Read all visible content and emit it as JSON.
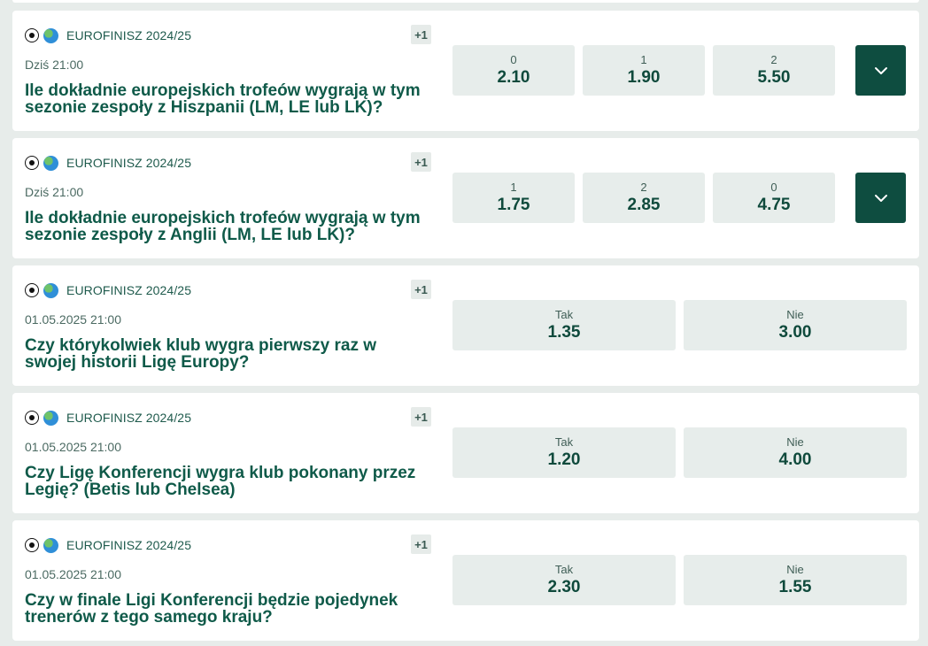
{
  "events": [
    {
      "league": "EUROFINISZ 2024/25",
      "badge": "+1",
      "time": "Dziś 21:00",
      "title": "Ile dokładnie europejskich trofeów wygrają w tym sezonie zespoły z Hiszpanii (LM, LE lub LK)?",
      "odds": [
        {
          "label": "0",
          "value": "2.10"
        },
        {
          "label": "1",
          "value": "1.90"
        },
        {
          "label": "2",
          "value": "5.50"
        }
      ],
      "has_expand": true
    },
    {
      "league": "EUROFINISZ 2024/25",
      "badge": "+1",
      "time": "Dziś 21:00",
      "title": "Ile dokładnie europejskich trofeów wygrają w tym sezonie zespoły z Anglii (LM, LE lub LK)?",
      "odds": [
        {
          "label": "1",
          "value": "1.75"
        },
        {
          "label": "2",
          "value": "2.85"
        },
        {
          "label": "0",
          "value": "4.75"
        }
      ],
      "has_expand": true
    },
    {
      "league": "EUROFINISZ 2024/25",
      "badge": "+1",
      "time": "01.05.2025 21:00",
      "title": "Czy którykolwiek klub wygra pierwszy raz w swojej historii Ligę Europy?",
      "odds": [
        {
          "label": "Tak",
          "value": "1.35"
        },
        {
          "label": "Nie",
          "value": "3.00"
        }
      ],
      "has_expand": false
    },
    {
      "league": "EUROFINISZ 2024/25",
      "badge": "+1",
      "time": "01.05.2025 21:00",
      "title": "Czy Ligę Konferencji wygra klub pokonany przez Legię? (Betis lub Chelsea)",
      "odds": [
        {
          "label": "Tak",
          "value": "1.20"
        },
        {
          "label": "Nie",
          "value": "4.00"
        }
      ],
      "has_expand": false
    },
    {
      "league": "EUROFINISZ 2024/25",
      "badge": "+1",
      "time": "01.05.2025 21:00",
      "title": "Czy w finale Ligi Konferencji będzie pojedynek trenerów z tego samego kraju?",
      "odds": [
        {
          "label": "Tak",
          "value": "2.30"
        },
        {
          "label": "Nie",
          "value": "1.55"
        }
      ],
      "has_expand": false
    }
  ]
}
